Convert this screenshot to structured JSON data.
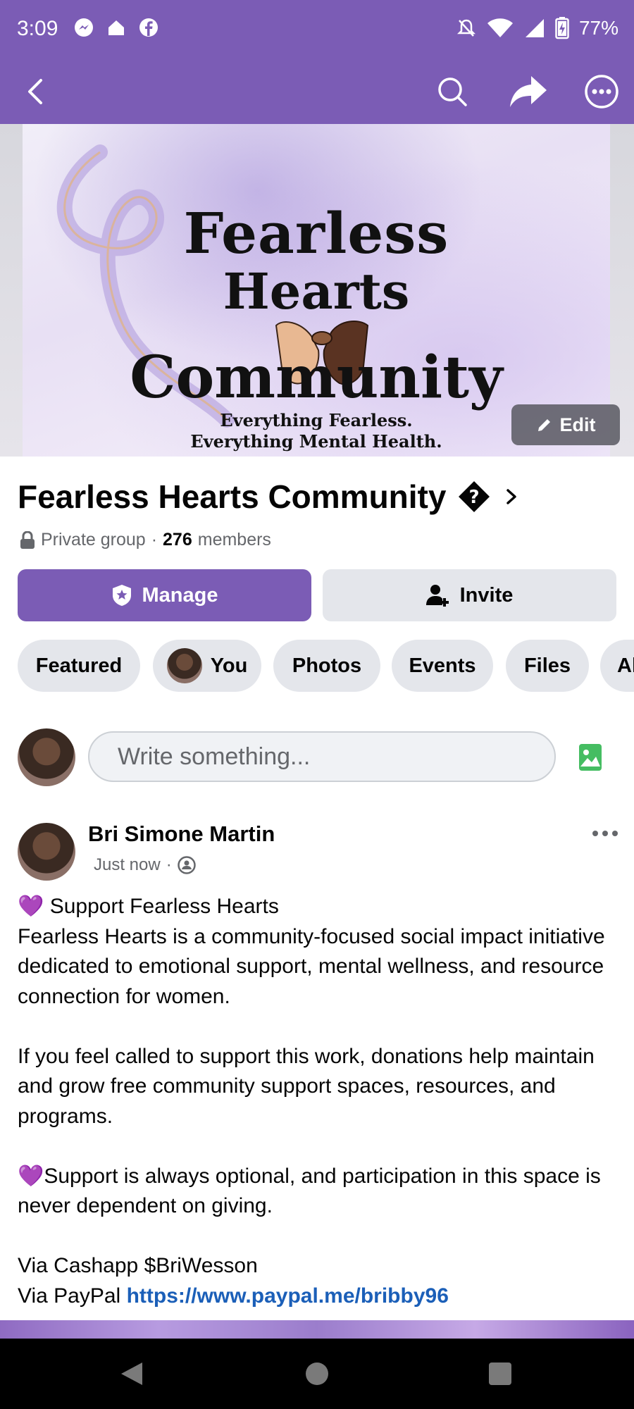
{
  "status_bar": {
    "time": "3:09",
    "battery": "77%",
    "left_icons": [
      "messenger-icon",
      "home-icon",
      "facebook-icon"
    ],
    "right_icons": [
      "bell-off-icon",
      "wifi-icon",
      "signal-icon",
      "battery-icon"
    ]
  },
  "cover": {
    "line1": "Fearless",
    "line2": "Hearts",
    "line3": "Community",
    "tagline1": "Everything Fearless.",
    "tagline2": "Everything Mental Health.",
    "edit_label": "Edit"
  },
  "group": {
    "name": "Fearless Hearts Community",
    "privacy": "Private group",
    "separator": "·",
    "member_count": "276",
    "members_label": "members",
    "manage_label": "Manage",
    "invite_label": "Invite"
  },
  "chips": [
    "Featured",
    "You",
    "Photos",
    "Events",
    "Files",
    "Al"
  ],
  "composer": {
    "placeholder": "Write something..."
  },
  "post": {
    "author": "Bri Simone Martin",
    "time": "Just now",
    "separator": "·",
    "heading": "Support Fearless Hearts",
    "para1": "Fearless Hearts is a community-focused social impact initiative dedicated to emotional support, mental wellness, and resource connection for women.",
    "para2": "If you feel called to support this work, donations help maintain and grow free community support spaces, resources, and programs.",
    "para3": "Support is always optional, and participation in this space is never dependent on giving.",
    "cashapp": "Via Cashapp $BriWesson",
    "paypal_prefix": "Via PayPal",
    "paypal_link": "https://www.paypal.me/bribby96",
    "emoji": "💜"
  },
  "colors": {
    "brand_purple": "#7b5cb5",
    "link_blue": "#1b5fb8",
    "chip_gray": "#e4e6eb",
    "meta_gray": "#65676b"
  }
}
